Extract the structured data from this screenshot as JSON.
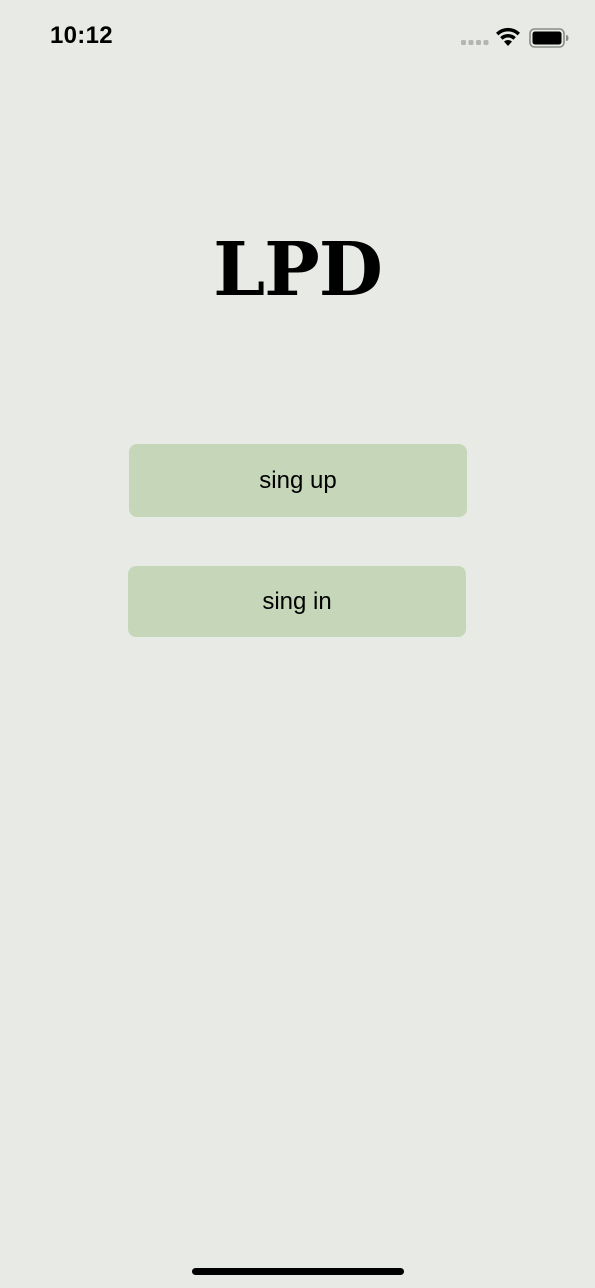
{
  "status_bar": {
    "time": "10:12",
    "icons": [
      "signal-icon",
      "wifi-icon",
      "battery-icon"
    ]
  },
  "app": {
    "title": "LPD"
  },
  "buttons": {
    "sign_up_label": "sing up",
    "sign_in_label": "sing in"
  },
  "colors": {
    "background": "#e8ebe5",
    "button_fill": "#c5d6b9",
    "text": "#000000"
  }
}
